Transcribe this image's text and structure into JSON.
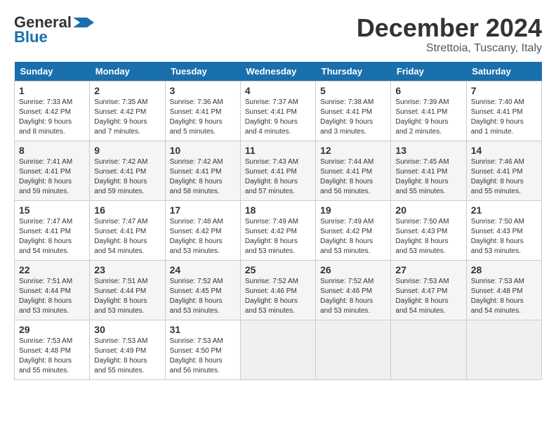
{
  "header": {
    "logo_line1": "General",
    "logo_line2": "Blue",
    "month": "December 2024",
    "location": "Strettoia, Tuscany, Italy"
  },
  "weekdays": [
    "Sunday",
    "Monday",
    "Tuesday",
    "Wednesday",
    "Thursday",
    "Friday",
    "Saturday"
  ],
  "weeks": [
    [
      {
        "day": "1",
        "sunrise": "7:33 AM",
        "sunset": "4:42 PM",
        "daylight": "9 hours and 8 minutes."
      },
      {
        "day": "2",
        "sunrise": "7:35 AM",
        "sunset": "4:42 PM",
        "daylight": "9 hours and 7 minutes."
      },
      {
        "day": "3",
        "sunrise": "7:36 AM",
        "sunset": "4:41 PM",
        "daylight": "9 hours and 5 minutes."
      },
      {
        "day": "4",
        "sunrise": "7:37 AM",
        "sunset": "4:41 PM",
        "daylight": "9 hours and 4 minutes."
      },
      {
        "day": "5",
        "sunrise": "7:38 AM",
        "sunset": "4:41 PM",
        "daylight": "9 hours and 3 minutes."
      },
      {
        "day": "6",
        "sunrise": "7:39 AM",
        "sunset": "4:41 PM",
        "daylight": "9 hours and 2 minutes."
      },
      {
        "day": "7",
        "sunrise": "7:40 AM",
        "sunset": "4:41 PM",
        "daylight": "9 hours and 1 minute."
      }
    ],
    [
      {
        "day": "8",
        "sunrise": "7:41 AM",
        "sunset": "4:41 PM",
        "daylight": "8 hours and 59 minutes."
      },
      {
        "day": "9",
        "sunrise": "7:42 AM",
        "sunset": "4:41 PM",
        "daylight": "8 hours and 59 minutes."
      },
      {
        "day": "10",
        "sunrise": "7:42 AM",
        "sunset": "4:41 PM",
        "daylight": "8 hours and 58 minutes."
      },
      {
        "day": "11",
        "sunrise": "7:43 AM",
        "sunset": "4:41 PM",
        "daylight": "8 hours and 57 minutes."
      },
      {
        "day": "12",
        "sunrise": "7:44 AM",
        "sunset": "4:41 PM",
        "daylight": "8 hours and 56 minutes."
      },
      {
        "day": "13",
        "sunrise": "7:45 AM",
        "sunset": "4:41 PM",
        "daylight": "8 hours and 55 minutes."
      },
      {
        "day": "14",
        "sunrise": "7:46 AM",
        "sunset": "4:41 PM",
        "daylight": "8 hours and 55 minutes."
      }
    ],
    [
      {
        "day": "15",
        "sunrise": "7:47 AM",
        "sunset": "4:41 PM",
        "daylight": "8 hours and 54 minutes."
      },
      {
        "day": "16",
        "sunrise": "7:47 AM",
        "sunset": "4:41 PM",
        "daylight": "8 hours and 54 minutes."
      },
      {
        "day": "17",
        "sunrise": "7:48 AM",
        "sunset": "4:42 PM",
        "daylight": "8 hours and 53 minutes."
      },
      {
        "day": "18",
        "sunrise": "7:49 AM",
        "sunset": "4:42 PM",
        "daylight": "8 hours and 53 minutes."
      },
      {
        "day": "19",
        "sunrise": "7:49 AM",
        "sunset": "4:42 PM",
        "daylight": "8 hours and 53 minutes."
      },
      {
        "day": "20",
        "sunrise": "7:50 AM",
        "sunset": "4:43 PM",
        "daylight": "8 hours and 53 minutes."
      },
      {
        "day": "21",
        "sunrise": "7:50 AM",
        "sunset": "4:43 PM",
        "daylight": "8 hours and 53 minutes."
      }
    ],
    [
      {
        "day": "22",
        "sunrise": "7:51 AM",
        "sunset": "4:44 PM",
        "daylight": "8 hours and 53 minutes."
      },
      {
        "day": "23",
        "sunrise": "7:51 AM",
        "sunset": "4:44 PM",
        "daylight": "8 hours and 53 minutes."
      },
      {
        "day": "24",
        "sunrise": "7:52 AM",
        "sunset": "4:45 PM",
        "daylight": "8 hours and 53 minutes."
      },
      {
        "day": "25",
        "sunrise": "7:52 AM",
        "sunset": "4:46 PM",
        "daylight": "8 hours and 53 minutes."
      },
      {
        "day": "26",
        "sunrise": "7:52 AM",
        "sunset": "4:46 PM",
        "daylight": "8 hours and 53 minutes."
      },
      {
        "day": "27",
        "sunrise": "7:53 AM",
        "sunset": "4:47 PM",
        "daylight": "8 hours and 54 minutes."
      },
      {
        "day": "28",
        "sunrise": "7:53 AM",
        "sunset": "4:48 PM",
        "daylight": "8 hours and 54 minutes."
      }
    ],
    [
      {
        "day": "29",
        "sunrise": "7:53 AM",
        "sunset": "4:48 PM",
        "daylight": "8 hours and 55 minutes."
      },
      {
        "day": "30",
        "sunrise": "7:53 AM",
        "sunset": "4:49 PM",
        "daylight": "8 hours and 55 minutes."
      },
      {
        "day": "31",
        "sunrise": "7:53 AM",
        "sunset": "4:50 PM",
        "daylight": "8 hours and 56 minutes."
      },
      null,
      null,
      null,
      null
    ]
  ],
  "labels": {
    "sunrise": "Sunrise:",
    "sunset": "Sunset:",
    "daylight": "Daylight:"
  }
}
